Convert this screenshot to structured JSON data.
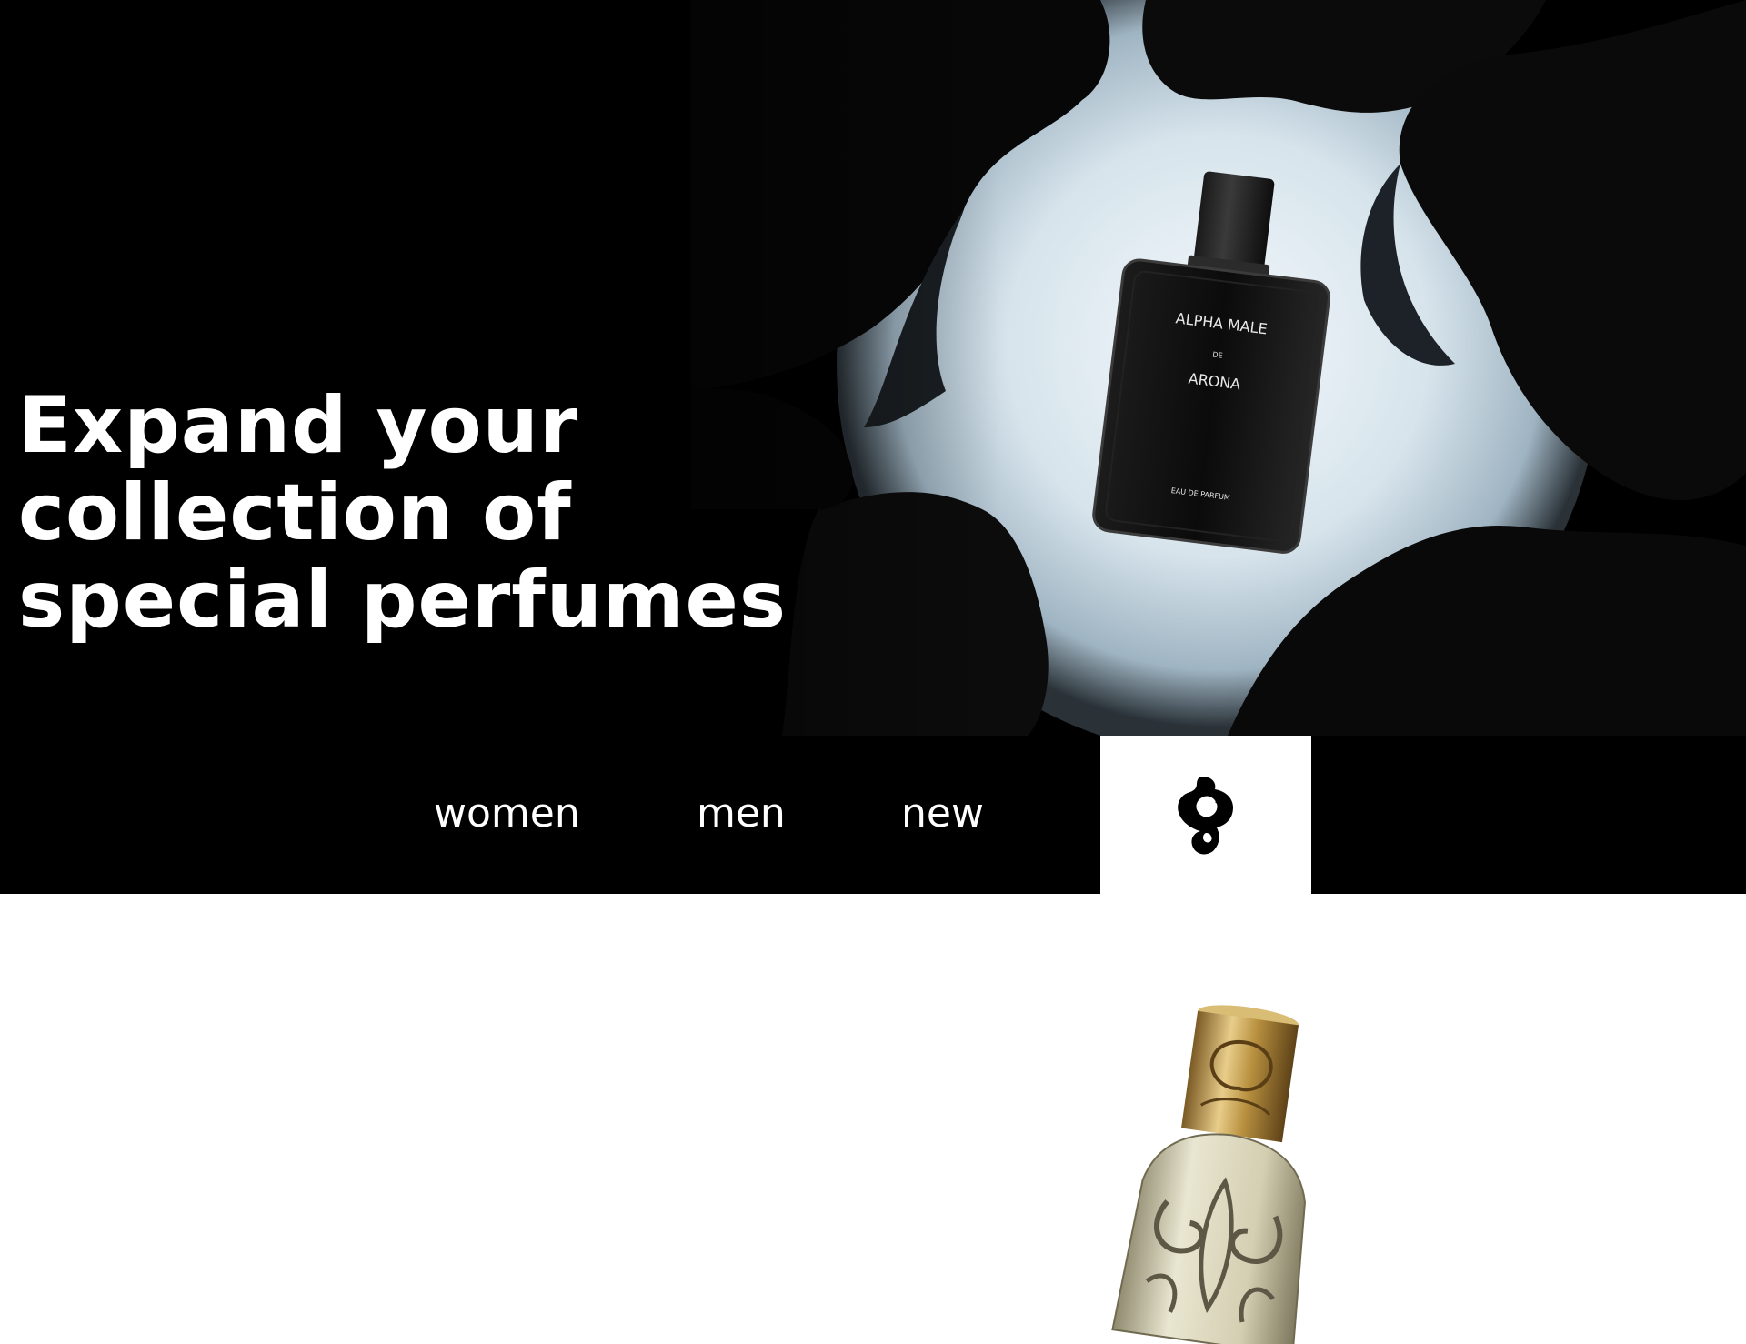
{
  "hero": {
    "headline_lines": [
      "Expand your",
      "collection of",
      "special perfumes"
    ],
    "bottle": {
      "brand": "ALPHA MALE",
      "by": "DE",
      "name": "ARONA",
      "type": "EAU DE PARFUM"
    }
  },
  "nav": {
    "items": [
      {
        "label": "women"
      },
      {
        "label": "men"
      },
      {
        "label": "new"
      }
    ],
    "logo_icon": "brand-logo-icon"
  },
  "colors": {
    "background": "#000000",
    "text": "#ffffff",
    "logo_box": "#ffffff",
    "glow": "#e3edf3",
    "gold": "#c9a35a"
  }
}
